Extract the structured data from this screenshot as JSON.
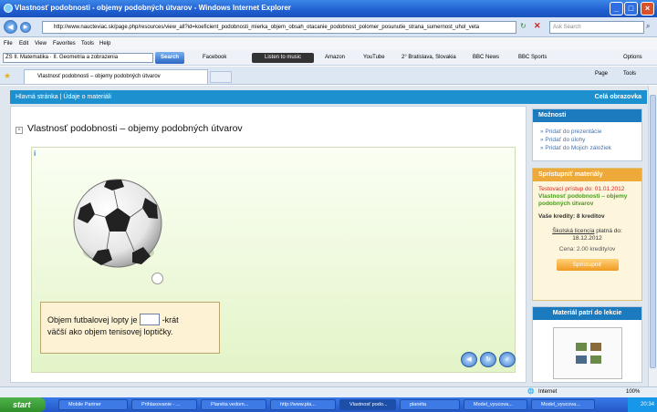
{
  "window": {
    "title": "Vlastnosť podobnosti - objemy podobných útvarov - Windows Internet Explorer"
  },
  "address": {
    "url": "http://www.naucteviac.sk/page.php/resources/view_all?id=koeficient_podobnosti_mierka_objem_obsah_otacanie_podobnost_polomer_posunutie_strana_sumernost_uhol_veta",
    "search_placeholder": "Ask Search"
  },
  "menu": [
    "File",
    "Edit",
    "View",
    "Favorites",
    "Tools",
    "Help"
  ],
  "toolbar": {
    "select_value": "ZŠ II. Matematika · II. Geometria a zobrazenia",
    "search_label": "Search",
    "items": [
      "Facebook",
      "Listen to music",
      "Amazon",
      "YouTube",
      "2° Bratislava, Slovakia",
      "BBC News",
      "BBC Sports",
      "Options"
    ]
  },
  "tabs": {
    "active": "Vlastnosť podobnosti – objemy podobných útvarov",
    "right": [
      "Page",
      "Tools"
    ]
  },
  "site": {
    "nav": "Hlavná stránka | Údaje o materiáli",
    "fullscreen": "Celá obrazovka"
  },
  "main": {
    "title": "Vlastnosť podobnosti – objemy podobných útvarov",
    "question_line1": "Objem futbalovej lopty je",
    "question_suffix": "-krát",
    "question_line2": "väčší ako objem tenisovej loptičky.",
    "info_icon": "i"
  },
  "moznosti": {
    "header": "Možnosti",
    "items": [
      "Pridať do prezentácie",
      "Pridať do úlohy",
      "Pridať do Mojich záložiek"
    ]
  },
  "sprist": {
    "header": "Sprístupniť materiály",
    "test": "Testovací prístup do: 01.01.2012",
    "material": "Vlastnosť podobnosti – objemy podobných útvarov",
    "credits": "Vaše kredity: 8 kreditov",
    "license_link": "Školská licencia",
    "license_rest": "platná do: 18.12.2012",
    "price": "Cena: 2.00 kredity/ov",
    "button": "Sprístupniť"
  },
  "mat": {
    "header": "Materiál patrí do lekcie"
  },
  "status": {
    "zone": "Internet",
    "zoom": "100%"
  },
  "taskbar": {
    "start": "start",
    "items": [
      "Mobile Partner",
      "Prihlasovanie - ...",
      "Planéta vedom...",
      "http://www.pla...",
      "Vlastnosť podo...",
      "planéta",
      "Model_vyucova...",
      "Model_vyucova..."
    ],
    "clock": "20:34"
  }
}
